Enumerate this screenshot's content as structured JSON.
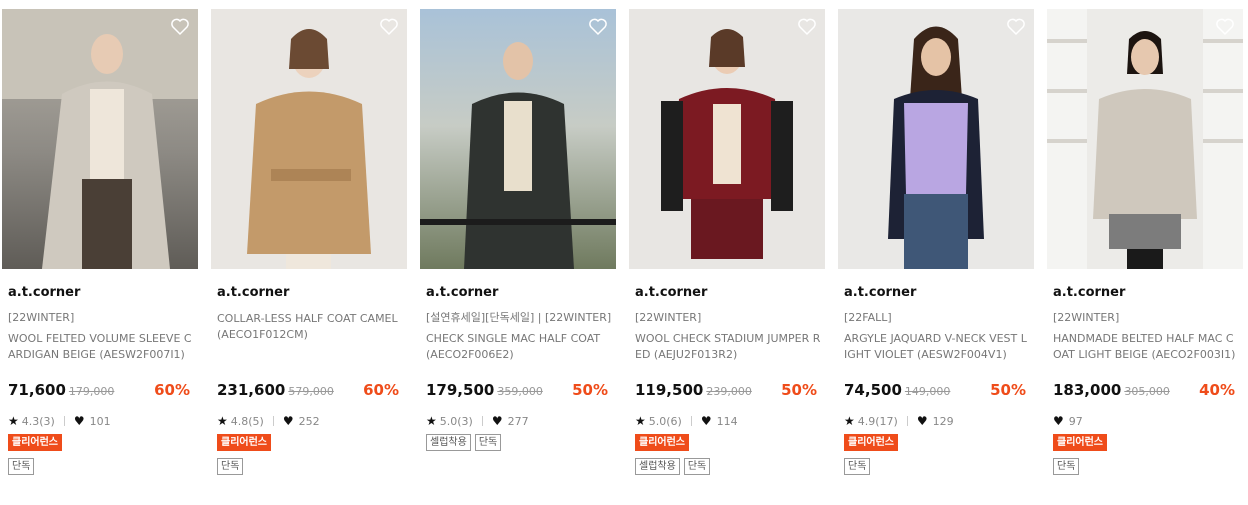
{
  "colors": {
    "accent": "#ef4c1a",
    "text": "#111111",
    "muted": "#777777"
  },
  "products": [
    {
      "brand": "a.t.corner",
      "category": "[22WINTER]",
      "name": "WOOL FELTED VOLUME SLEEVE CARDIGAN BEIGE (AESW2F007I1)",
      "price": "71,600",
      "original_price": "179,000",
      "discount": "60%",
      "rating": "4.3(3)",
      "likes": "101",
      "badge": "클리어런스",
      "tags": [
        "단독"
      ]
    },
    {
      "brand": "a.t.corner",
      "category": "",
      "name": "COLLAR-LESS HALF COAT CAMEL (AECO1F012CM)",
      "price": "231,600",
      "original_price": "579,000",
      "discount": "60%",
      "rating": "4.8(5)",
      "likes": "252",
      "badge": "클리어런스",
      "tags": [
        "단독"
      ]
    },
    {
      "brand": "a.t.corner",
      "category": "[설연휴세일][단독세일] | [22WINTER]",
      "name": "CHECK SINGLE MAC HALF COAT (AECO2F006E2)",
      "price": "179,500",
      "original_price": "359,000",
      "discount": "50%",
      "rating": "5.0(3)",
      "likes": "277",
      "badge": "",
      "tags": [
        "셀럽착용",
        "단독"
      ]
    },
    {
      "brand": "a.t.corner",
      "category": "[22WINTER]",
      "name": "WOOL CHECK STADIUM JUMPER RED (AEJU2F013R2)",
      "price": "119,500",
      "original_price": "239,000",
      "discount": "50%",
      "rating": "5.0(6)",
      "likes": "114",
      "badge": "클리어런스",
      "tags": [
        "셀럽착용",
        "단독"
      ]
    },
    {
      "brand": "a.t.corner",
      "category": "[22FALL]",
      "name": "ARGYLE JAQUARD V-NECK VEST LIGHT VIOLET (AESW2F004V1)",
      "price": "74,500",
      "original_price": "149,000",
      "discount": "50%",
      "rating": "4.9(17)",
      "likes": "129",
      "badge": "클리어런스",
      "tags": [
        "단독"
      ]
    },
    {
      "brand": "a.t.corner",
      "category": "[22WINTER]",
      "name": "HANDMADE BELTED HALF MAC COAT LIGHT BEIGE (AECO2F003I1)",
      "price": "183,000",
      "original_price": "305,000",
      "discount": "40%",
      "rating": "",
      "likes": "97",
      "badge": "클리어런스",
      "tags": [
        "단독"
      ]
    }
  ]
}
